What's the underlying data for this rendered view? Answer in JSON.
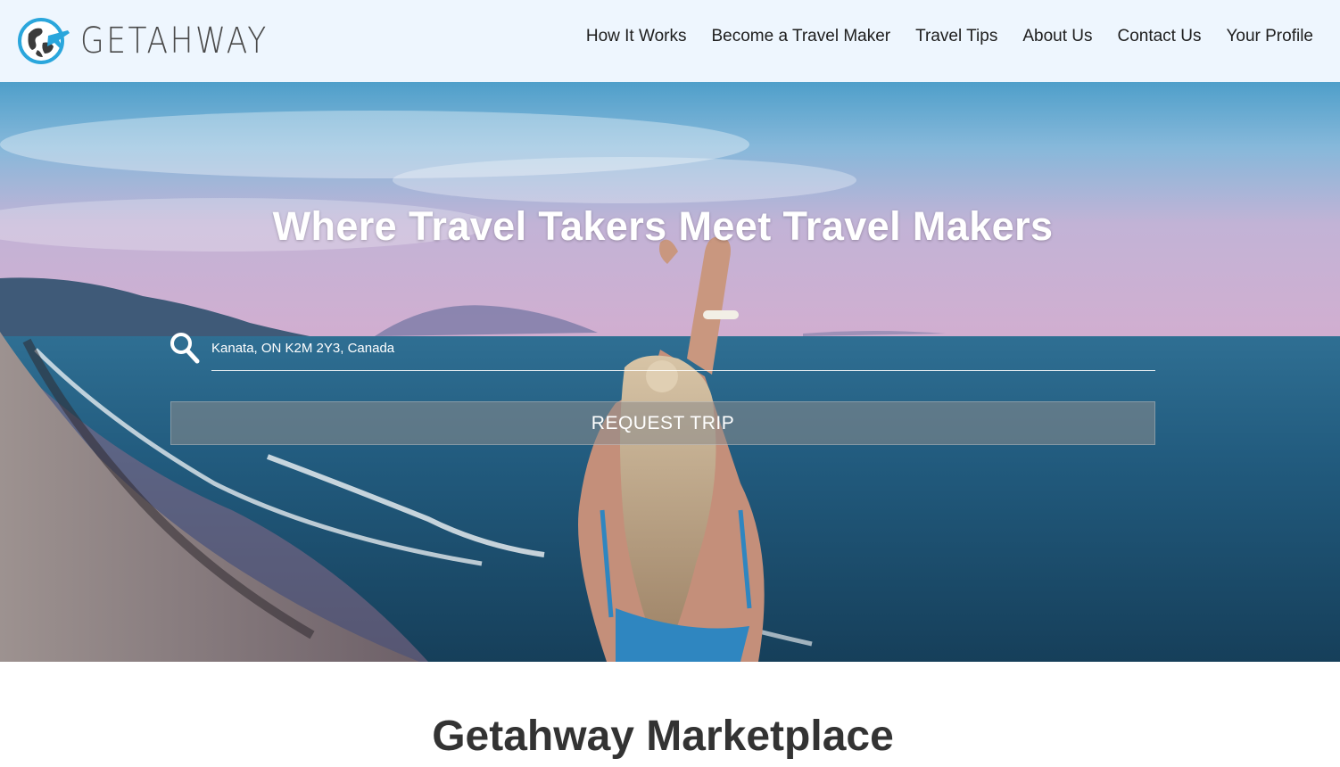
{
  "brand": {
    "name": "GETAHWAY",
    "accent": "#2aa6dc",
    "text_color": "#4a4a4a"
  },
  "nav": {
    "items": [
      {
        "label": "How It Works"
      },
      {
        "label": "Become a Travel Maker"
      },
      {
        "label": "Travel Tips"
      },
      {
        "label": "About Us"
      },
      {
        "label": "Contact Us"
      },
      {
        "label": "Your Profile"
      }
    ]
  },
  "hero": {
    "title": "Where Travel Takers Meet Travel Makers",
    "search": {
      "value": "Kanata, ON K2M 2Y3, Canada",
      "icon": "search-icon"
    },
    "button_label": "REQUEST TRIP"
  },
  "marketplace": {
    "title": "Getahway Marketplace"
  },
  "colors": {
    "header_bg": "#eef6fe",
    "button_bg": "rgba(140,140,140,0.55)",
    "heading": "#333333"
  }
}
